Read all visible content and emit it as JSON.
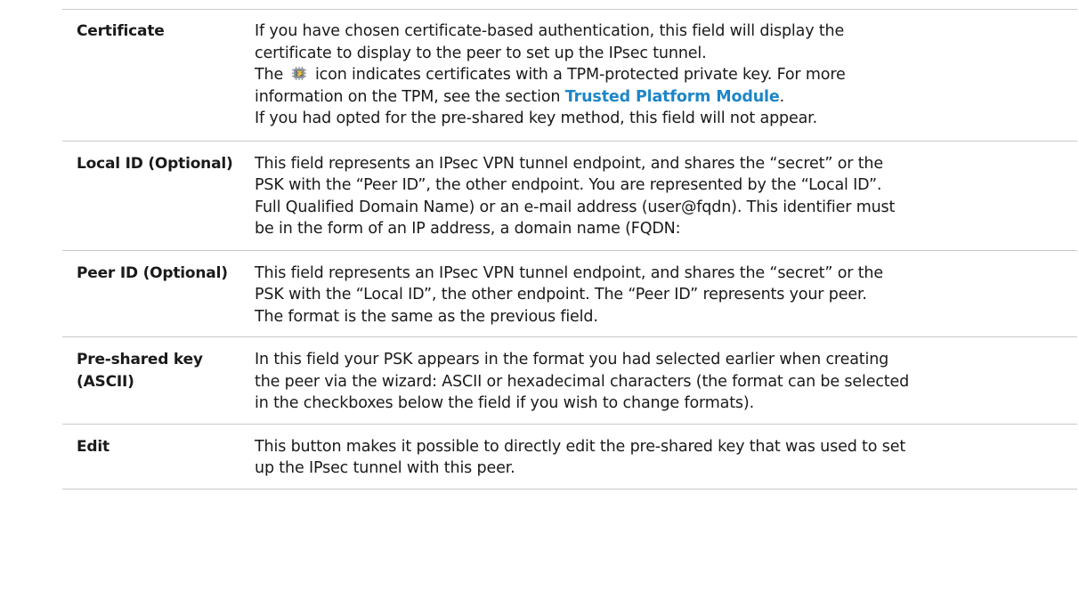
{
  "rows": [
    {
      "term": "Certificate",
      "lines": [
        "If you have chosen certificate-based authentication, this field will display the",
        "certificate to display to the peer to set up the IPsec tunnel."
      ],
      "icon_line_before": "The",
      "icon_line_after": "icon indicates certificates with a TPM-protected private key. For more",
      "link_line_before": "information on the TPM, see the section",
      "link_text": "Trusted Platform Module",
      "link_line_after": ".",
      "last_line": "If you had opted for the pre-shared key method, this field will not appear.",
      "icon": "tpm-chip-icon"
    },
    {
      "term": "Local ID (Optional)",
      "lines": [
        "This field represents an IPsec VPN tunnel endpoint, and shares the “secret” or the",
        "PSK with the “Peer ID”, the other endpoint. You are represented by the “Local ID”.",
        "Full Qualified Domain Name) or an e-mail address (user@fqdn). This identifier must",
        "be in the form of an IP address, a domain name (FQDN:"
      ]
    },
    {
      "term": "Peer ID (Optional)",
      "lines": [
        "This field represents an IPsec VPN tunnel endpoint, and shares the “secret” or the",
        "PSK with the “Local ID”, the other endpoint. The “Peer ID” represents your peer.",
        "The format is the same as the previous field."
      ]
    },
    {
      "term_lines": [
        "Pre-shared key",
        "(ASCII)"
      ],
      "lines": [
        "In this field your PSK appears in the format you had selected earlier when creating",
        "the peer via the wizard: ASCII or hexadecimal characters (the format can be selected",
        "in the checkboxes below the field if you wish to change formats)."
      ]
    },
    {
      "term": "Edit",
      "lines": [
        "This button makes it possible to directly edit the pre-shared key that was used to set",
        "up the IPsec tunnel with this peer."
      ]
    }
  ],
  "colors": {
    "link": "#1e86c6",
    "rule": "#c8c8c8",
    "text": "#1a1a1a"
  }
}
